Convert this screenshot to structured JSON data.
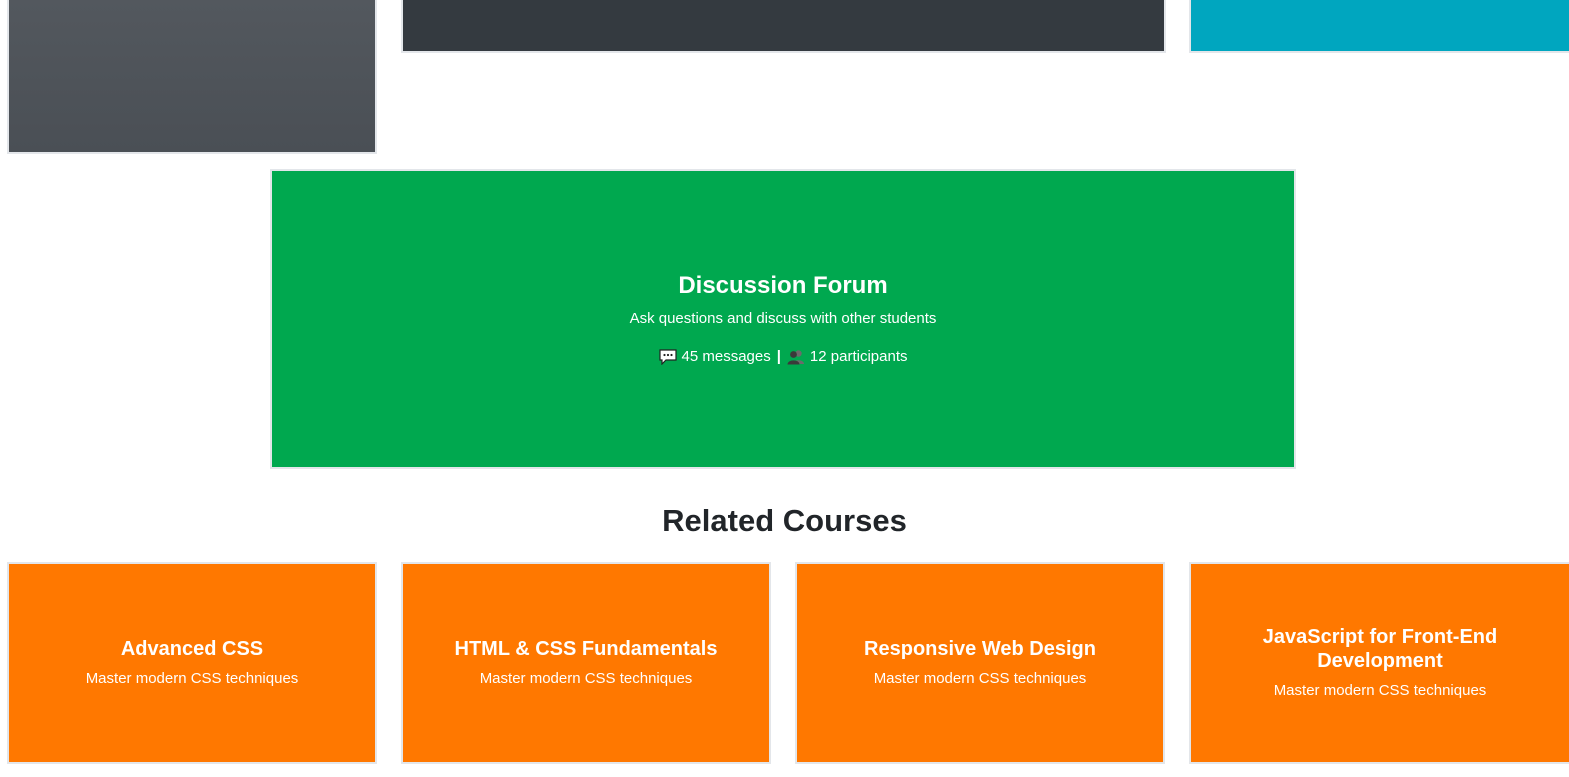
{
  "forum": {
    "title": "Discussion Forum",
    "description": "Ask questions and discuss with other students",
    "messages_text": "45 messages",
    "separator": "|",
    "participants_text": "12 participants",
    "messages_icon": "speech-bubble-icon",
    "participants_icon": "people-icon"
  },
  "related": {
    "heading": "Related Courses",
    "courses": [
      {
        "title": "Advanced CSS",
        "description": "Master modern CSS techniques"
      },
      {
        "title": "HTML & CSS Fundamentals",
        "description": "Master modern CSS techniques"
      },
      {
        "title": "Responsive Web Design",
        "description": "Master modern CSS techniques"
      },
      {
        "title": "JavaScript for Front-End Development",
        "description": "Master modern CSS techniques"
      }
    ]
  },
  "colors": {
    "forum_bg": "#00a84f",
    "course_bg": "#ff7800",
    "tile_gray": "#4a4f55",
    "tile_dark": "#343a40",
    "tile_teal": "#00a6bf",
    "heading_text": "#212529"
  }
}
